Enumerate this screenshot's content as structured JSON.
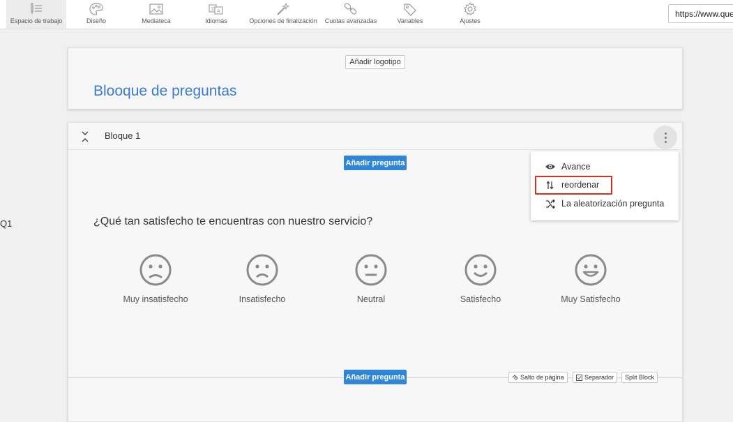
{
  "toolbar": {
    "tabs": [
      {
        "label": "Espacio de trabajo",
        "icon": "workspace-icon"
      },
      {
        "label": "Diseño",
        "icon": "palette-icon"
      },
      {
        "label": "Mediateca",
        "icon": "image-icon"
      },
      {
        "label": "Idiomas",
        "icon": "translate-icon"
      },
      {
        "label": "Opciones de finalización",
        "icon": "magic-wand-icon"
      },
      {
        "label": "Cuotas avanzadas",
        "icon": "chain-icon"
      },
      {
        "label": "Variables",
        "icon": "tag-icon"
      },
      {
        "label": "Ajustes",
        "icon": "gear-icon"
      }
    ],
    "url": "https://www.ques"
  },
  "header_card": {
    "add_logo_label": "Añadir logotipo",
    "survey_title": "Blooque de preguntas"
  },
  "block": {
    "name": "Bloque 1",
    "add_question_label": "Añadir pregunta",
    "question_id": "Q1",
    "question_text": "¿Qué tan satisfecho te encuentras con nuestro servicio?",
    "options": [
      {
        "label": "Muy insatisfecho",
        "icon": "very-unhappy-face-icon"
      },
      {
        "label": "Insatisfecho",
        "icon": "unhappy-face-icon"
      },
      {
        "label": "Neutral",
        "icon": "neutral-face-icon"
      },
      {
        "label": "Satisfecho",
        "icon": "happy-face-icon"
      },
      {
        "label": "Muy Satisfecho",
        "icon": "very-happy-face-icon"
      }
    ],
    "footer": {
      "add_question_label": "Añadir pregunta",
      "page_break_label": "Salto de página",
      "separator_label": "Separador",
      "split_block_label": "Split Block"
    }
  },
  "menu": {
    "items": [
      {
        "label": "Avance",
        "icon": "eye-icon"
      },
      {
        "label": "reordenar",
        "icon": "reorder-arrows-icon",
        "highlighted": true
      },
      {
        "label": "La aleatorización pregunta",
        "icon": "shuffle-icon"
      }
    ]
  },
  "colors": {
    "accent": "#2f86d8",
    "title_blue": "#3a7bd5",
    "highlight_red": "#d93025",
    "icon_gray": "#8a8a8a"
  }
}
